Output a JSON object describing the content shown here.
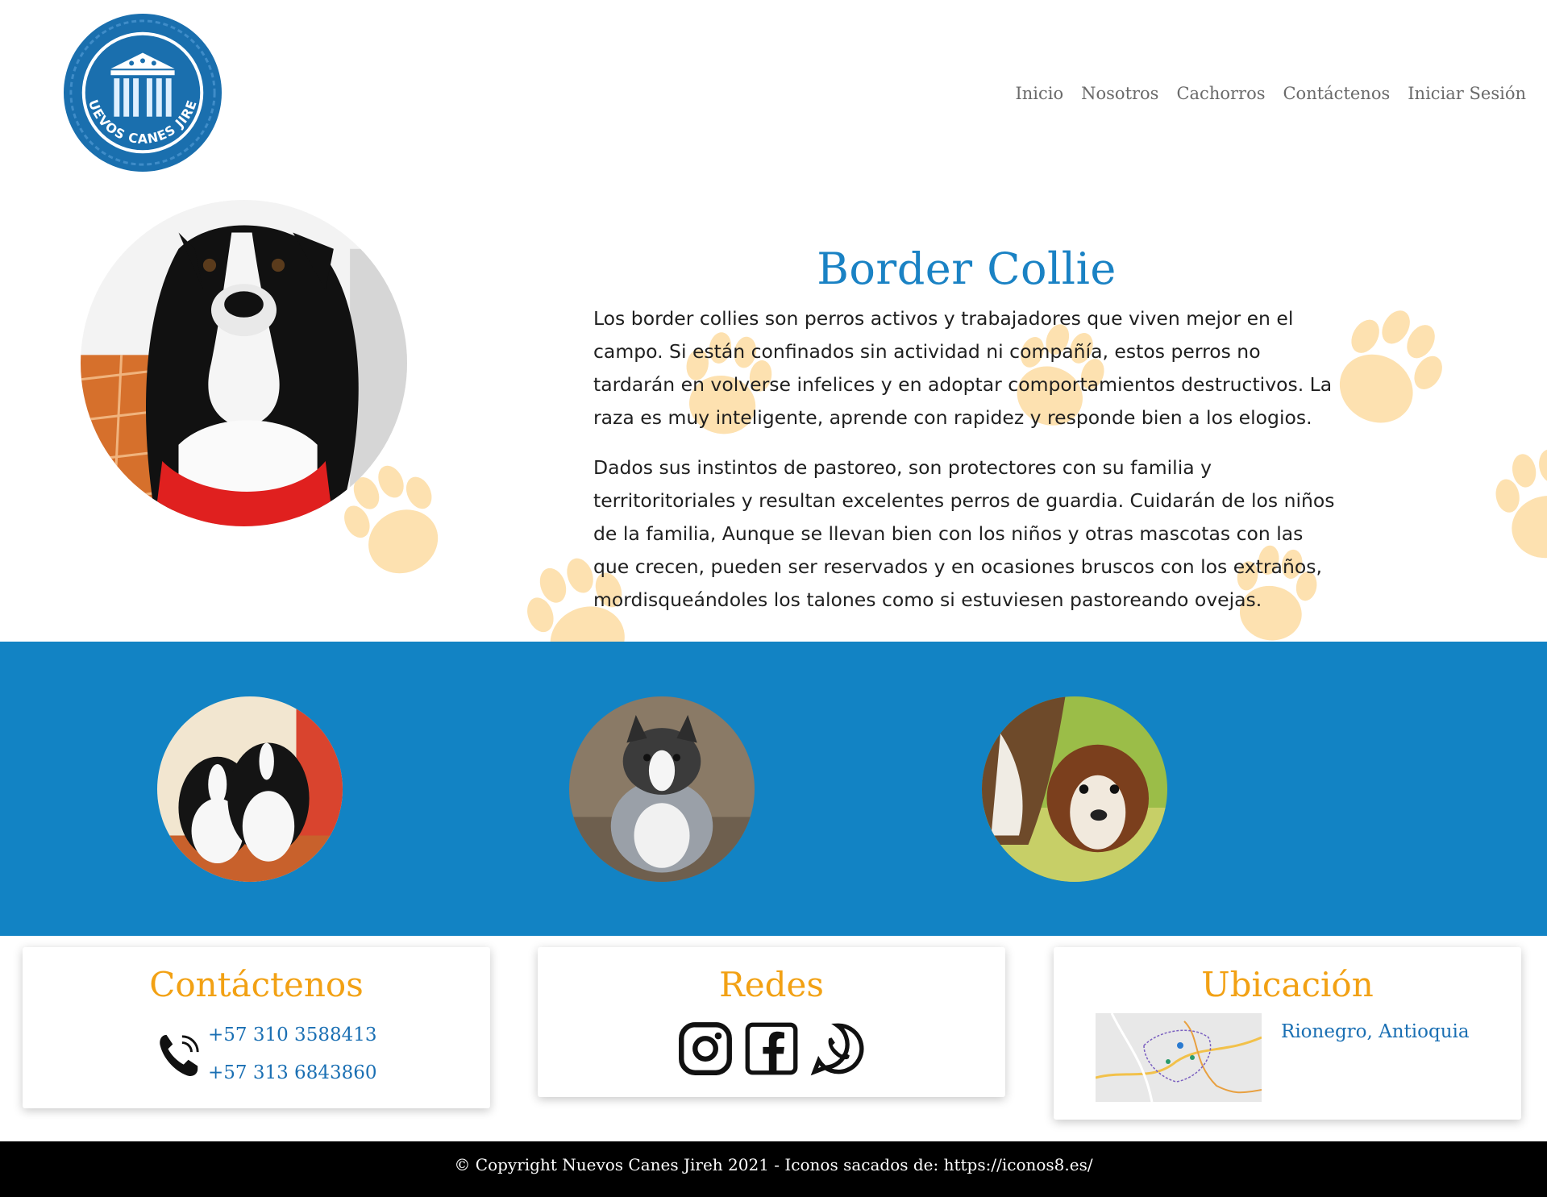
{
  "brand": {
    "logo_alt": "Nuevos Canes Jireh",
    "logo_text": "NUEVOS CANES JIREH"
  },
  "nav": {
    "items": [
      {
        "label": "Inicio"
      },
      {
        "label": "Nosotros"
      },
      {
        "label": "Cachorros"
      },
      {
        "label": "Contáctenos"
      },
      {
        "label": "Iniciar Sesión"
      }
    ]
  },
  "hero": {
    "title": "Border Collie",
    "paragraph1": "Los border collies son perros activos y trabajadores que viven mejor en el campo. Si están confinados sin actividad ni compañía, estos perros no tardarán en volverse infelices y en adoptar comportamientos destructivos. La raza es muy inteligente, aprende con rapidez y responde bien a los elogios.",
    "paragraph2": "Dados sus instintos de pastoreo, son protectores con su familia y territoritoriales y resultan excelentes perros de guardia. Cuidarán de los niños de la familia, Aunque se llevan bien con los niños y otras mascotas con las que crecen, pueden ser reservados y en ocasiones bruscos con los extraños, mordisqueándoles los talones como si estuviesen pastoreando ovejas."
  },
  "cards": {
    "contact": {
      "title": "Contáctenos",
      "phone1": "+57 310 3588413",
      "phone2": "+57 313 6843860",
      "icon": "phone-icon"
    },
    "social": {
      "title": "Redes",
      "icons": [
        "instagram-icon",
        "facebook-icon",
        "whatsapp-icon"
      ]
    },
    "location": {
      "title": "Ubicación",
      "place": "Rionegro, Antioquia"
    }
  },
  "footer": {
    "text": "© Copyright Nuevos Canes Jireh 2021 - Iconos sacados de: https://iconos8.es/"
  },
  "colors": {
    "accent_blue": "#1283c4",
    "title_blue": "#1a82c4",
    "orange": "#f2a114",
    "paw": "#fde1b0"
  }
}
